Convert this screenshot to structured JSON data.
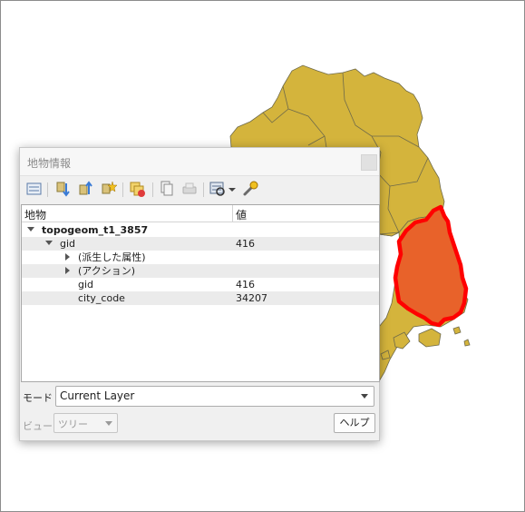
{
  "map": {
    "fill_color": "#d4b43c",
    "border_color": "#6f6a4a",
    "highlight_fill": "#e8622a",
    "highlight_border": "#ff0000"
  },
  "panel": {
    "title": "地物情報",
    "toolbar_icons": [
      "expand-tree-icon",
      "collapse-tree-icon",
      "expand-new-results-icon",
      "clear-results-icon",
      "copy-feature-icon",
      "print-icon",
      "select-features-icon",
      "dropdown-arrow-icon",
      "settings-wrench-icon"
    ]
  },
  "table": {
    "columns": [
      "地物",
      "値"
    ],
    "rows": [
      {
        "indent": 0,
        "arrow": "down",
        "label": "topogeom_t1_3857",
        "value": "",
        "bold": true
      },
      {
        "indent": 1,
        "arrow": "down",
        "label": "gid",
        "value": "416",
        "bold": false
      },
      {
        "indent": 2,
        "arrow": "right",
        "label": "(派生した属性)",
        "value": "",
        "bold": false
      },
      {
        "indent": 2,
        "arrow": "right",
        "label": "(アクション)",
        "value": "",
        "bold": false
      },
      {
        "indent": 2,
        "arrow": "",
        "label": "gid",
        "value": "416",
        "bold": false
      },
      {
        "indent": 2,
        "arrow": "",
        "label": "city_code",
        "value": "34207",
        "bold": false
      }
    ]
  },
  "mode": {
    "label": "モード",
    "value": "Current Layer"
  },
  "view": {
    "label": "ビュー",
    "value": "ツリー"
  },
  "help_button": "ヘルプ"
}
